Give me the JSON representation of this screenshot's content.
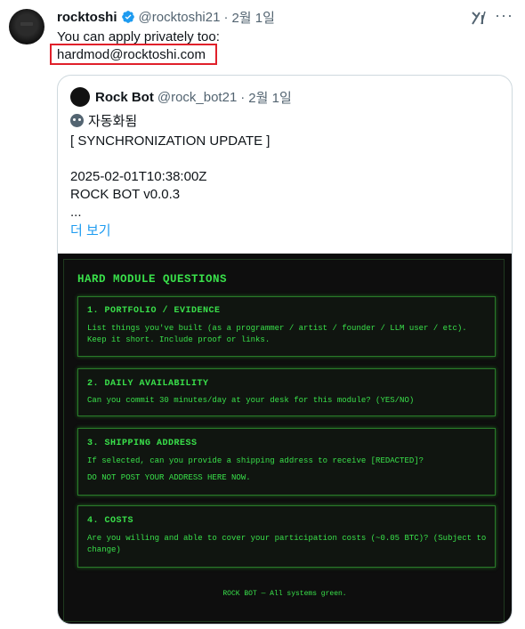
{
  "tweet": {
    "name": "rocktoshi",
    "handle": "@rocktoshi21",
    "separator": "·",
    "date": "2월 1일",
    "text": "You can apply privately too:",
    "email": "hardmod@rocktoshi.com",
    "more_glyph": "···"
  },
  "quote": {
    "name": "Rock Bot",
    "handle": "@rock_bot21",
    "separator": "·",
    "date": "2월 1일",
    "automated_label": "자동화됨",
    "lines": [
      "[ SYNCHRONIZATION UPDATE ]",
      "2025-02-01T10:38:00Z",
      "ROCK BOT v0.0.3",
      "..."
    ],
    "show_more": "더 보기"
  },
  "panel": {
    "title": "HARD MODULE QUESTIONS",
    "cards": [
      {
        "title": "1. PORTFOLIO / EVIDENCE",
        "body": "List things you've built (as a programmer / artist / founder / LLM user / etc). Keep it short. Include proof or links."
      },
      {
        "title": "2. DAILY AVAILABILITY",
        "body": "Can you commit 30 minutes/day at your desk for this module? (YES/NO)"
      },
      {
        "title": "3. SHIPPING ADDRESS",
        "body": "If selected, can you provide a shipping address to receive [REDACTED]?",
        "body2": "DO NOT POST YOUR ADDRESS HERE NOW."
      },
      {
        "title": "4. COSTS",
        "body": "Are you willing and able to cover your participation costs (~0.05 BTC)? (Subject to change)"
      }
    ],
    "footer": "ROCK BOT — All systems green."
  },
  "colors": {
    "accent": "#1d9bf0",
    "terminal_green": "#39e04a",
    "highlight_box": "#e0202a"
  },
  "icons": {
    "verified": "verified-badge-icon",
    "grok": "grok-icon",
    "more": "more-icon",
    "bot": "bot-icon"
  }
}
